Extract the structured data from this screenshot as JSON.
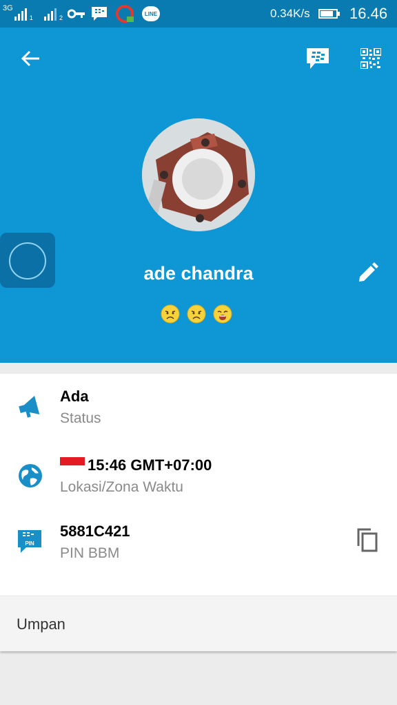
{
  "statusbar": {
    "network": "3G",
    "sim1": "1",
    "sim2": "2",
    "line_label": "LINE",
    "speed": "0.34K/s",
    "time": "16.46"
  },
  "appbar": {
    "back_icon": "back-arrow-icon",
    "bbm_icon": "bbm-chat-icon",
    "qr_icon": "qr-code-icon"
  },
  "profile": {
    "name": "ade chandra",
    "emoticons": [
      "sad-face-icon",
      "sad-face-icon",
      "crying-face-icon"
    ]
  },
  "info": {
    "status": {
      "value": "Ada",
      "label": "Status"
    },
    "location": {
      "value": "15:46 GMT+07:00",
      "label": "Lokasi/Zona Waktu"
    },
    "pin": {
      "value": "5881C421",
      "label": "PIN BBM",
      "pin_badge": "PIN"
    }
  },
  "feed": {
    "label": "Umpan"
  },
  "colors": {
    "statusbar": "#0a7bb0",
    "header": "#0f96d4",
    "icon_blue": "#1a8fc7"
  }
}
